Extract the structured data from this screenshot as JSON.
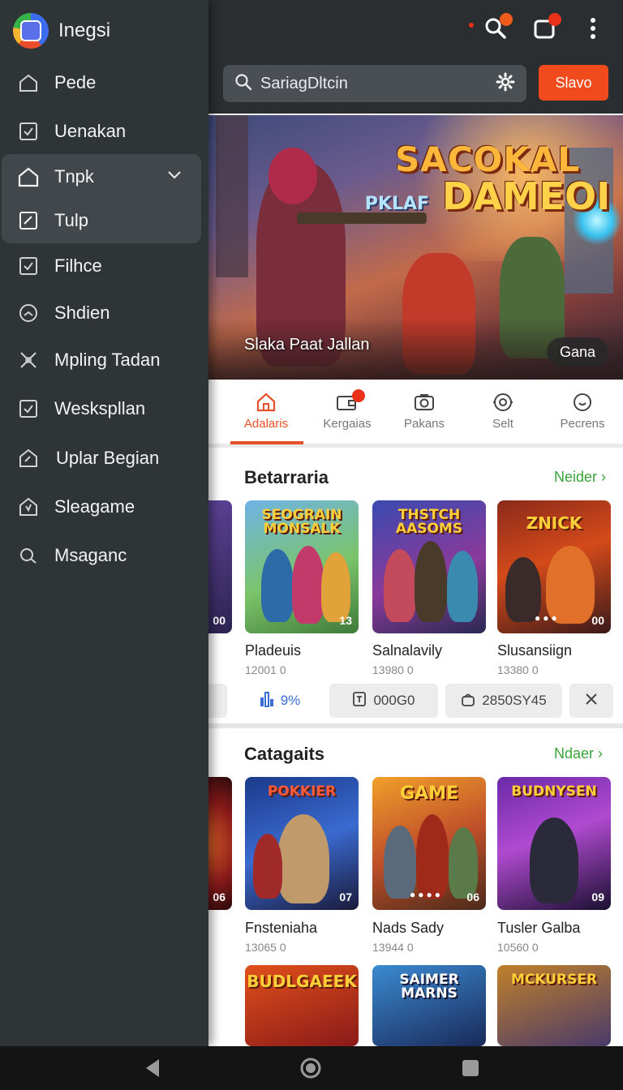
{
  "drawer": {
    "app_name": "Inegsi",
    "items": [
      {
        "label": "Pede"
      },
      {
        "label": "Uenakan"
      },
      {
        "label": "Tnpk"
      },
      {
        "label": "Tulp"
      },
      {
        "label": "Filhce"
      },
      {
        "label": "Shdien"
      },
      {
        "label": "Mpling Tadan"
      },
      {
        "label": "Weskspllan"
      },
      {
        "label": "Uplar Begian"
      },
      {
        "label": "Sleagame"
      },
      {
        "label": "Msaganc"
      }
    ]
  },
  "header": {
    "search_text": "SariagDltcin",
    "action_button": "Slavo"
  },
  "hero": {
    "title_line1": "SACOKAL",
    "title_line2_small": "PKLAF",
    "title_line2": "DAMEOI",
    "caption": "Slaka Paat Jallan",
    "pill": "Gana"
  },
  "tabs": [
    {
      "label": "Adalaris"
    },
    {
      "label": "Kergaias"
    },
    {
      "label": "Pakans"
    },
    {
      "label": "Selt"
    },
    {
      "label": "Pecrens"
    }
  ],
  "section1": {
    "title": "Betarraria",
    "see_all": "Neider",
    "cards": [
      {
        "title": "SEOGRAIN MONSALK",
        "name": "Pladeuis",
        "value": "12001 0",
        "badge": "13"
      },
      {
        "title": "THSTCH AASOMS",
        "name": "Salnalavily",
        "value": "13980 0",
        "badge": ""
      },
      {
        "title": "ZNICK",
        "name": "Slusansiign",
        "value": "13380 0",
        "badge": "00"
      }
    ],
    "partial_badge": "00"
  },
  "chips": {
    "first": "9%",
    "second": "000G0",
    "third": "2850SY45"
  },
  "section2": {
    "title": "Catagaits",
    "see_all": "Ndaer",
    "cards": [
      {
        "title": "POKKIER",
        "name": "Fnsteniaha",
        "value": "13065 0",
        "badge": "07"
      },
      {
        "title": "GAME",
        "name": "Nads Sady",
        "value": "13944 0",
        "badge": "06"
      },
      {
        "title": "BUDNYSEN",
        "name": "Tusler Galba",
        "value": "10560 0",
        "badge": "09"
      }
    ],
    "partial_badge": "06",
    "row2_titles": [
      "BUDLGAEEK",
      "SAIMER MARNS",
      "MCKURSER"
    ]
  },
  "colors": {
    "accent": "#e8502a",
    "link": "#3aa23a",
    "drawer_bg": "#2f3437"
  }
}
